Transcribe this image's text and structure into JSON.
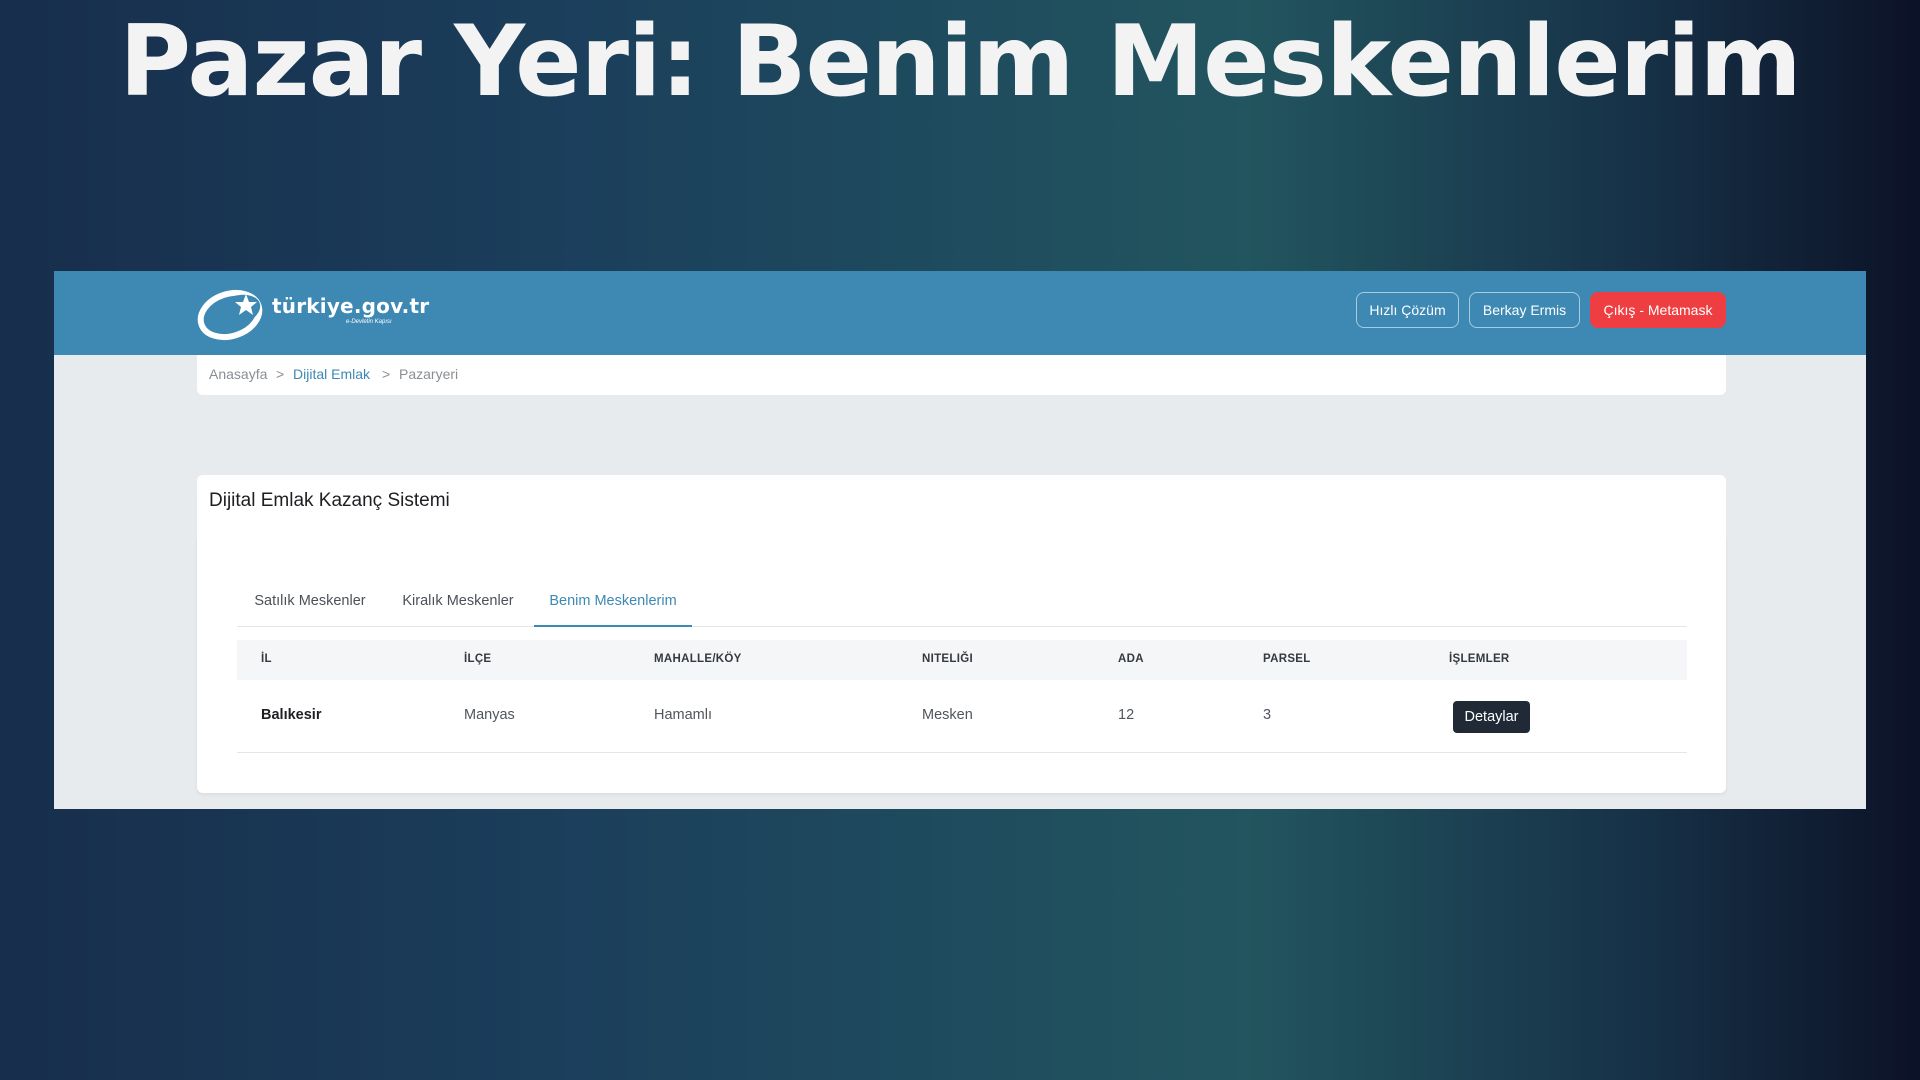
{
  "slide": {
    "title": "Pazar Yeri: Benim Meskenlerim"
  },
  "header": {
    "logo_text": "türkiye.gov.tr",
    "logo_tagline": "e-Devletin Kapısı",
    "buttons": {
      "quick": "Hızlı Çözüm",
      "user": "Berkay Ermis",
      "exit": "Çıkış - Metamask"
    }
  },
  "breadcrumb": {
    "items": [
      "Anasayfa",
      "Dijital Emlak",
      "Pazaryeri"
    ],
    "separator": ">"
  },
  "card": {
    "title": "Dijital Emlak Kazanç Sistemi"
  },
  "tabs": [
    {
      "label": "Satılık Meskenler"
    },
    {
      "label": "Kiralık Meskenler"
    },
    {
      "label": "Benim Meskenlerim",
      "active": true
    }
  ],
  "table": {
    "headers": [
      "İL",
      "İLÇE",
      "MAHALLE/KÖY",
      "NITELIĞI",
      "ADA",
      "PARSEL",
      "İŞLEMLER"
    ],
    "rows": [
      {
        "il": "Balıkesir",
        "ilce": "Manyas",
        "mahalle": "Hamamlı",
        "niteligi": "Mesken",
        "ada": "12",
        "parsel": "3",
        "action": "Detaylar"
      }
    ]
  },
  "colors": {
    "primary": "#3d89b4",
    "danger": "#ef3e42",
    "dark_button": "#1f2a36"
  }
}
